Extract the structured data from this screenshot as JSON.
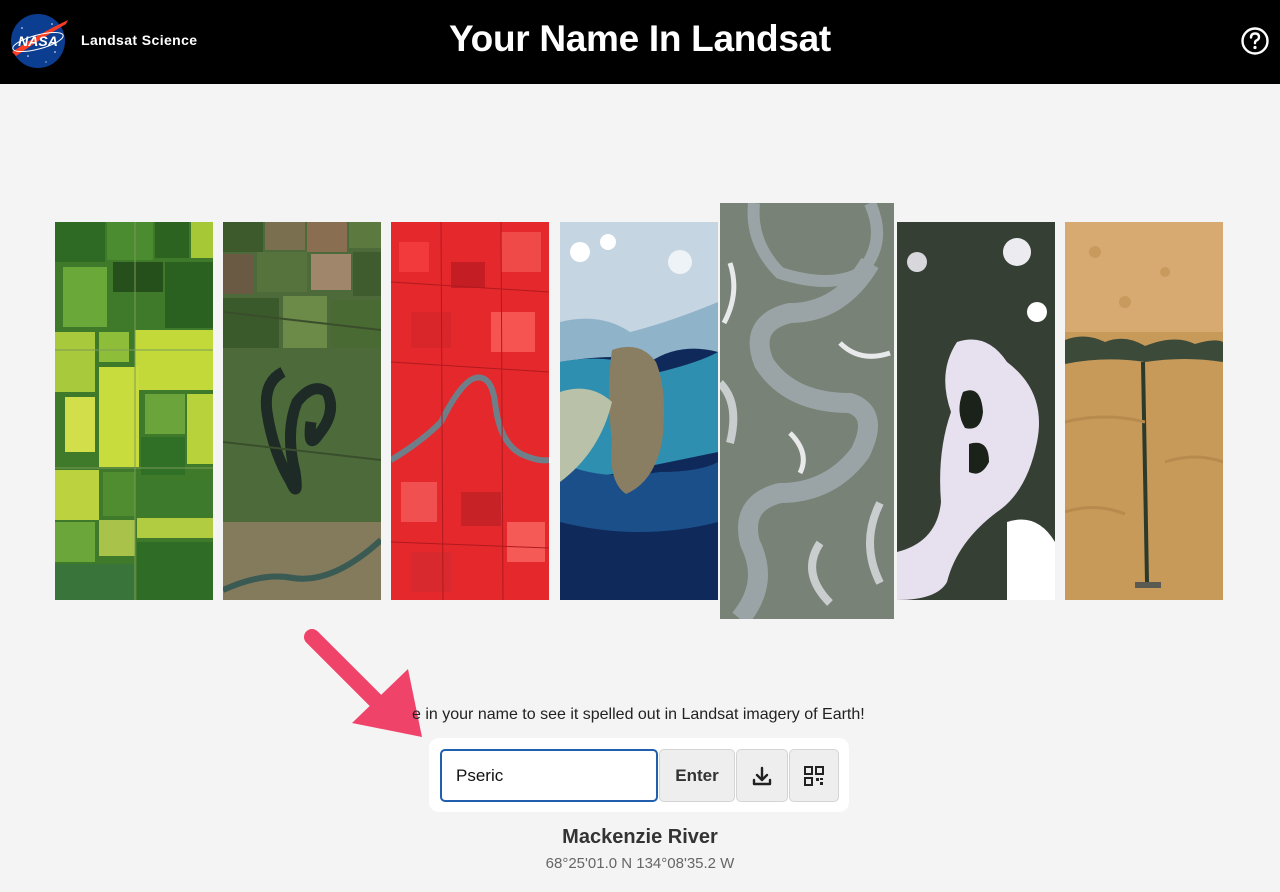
{
  "header": {
    "logo_text": "NASA",
    "brand": "Landsat Science",
    "title": "Your Name In Landsat",
    "help_icon": "help-circle-icon"
  },
  "letters": [
    {
      "name": "tile-1",
      "palette": "green-farmland"
    },
    {
      "name": "tile-2",
      "palette": "green-brown-fields-river"
    },
    {
      "name": "tile-3",
      "palette": "red-false-color-river"
    },
    {
      "name": "tile-4",
      "palette": "blue-sea-island"
    },
    {
      "name": "tile-5",
      "palette": "dark-green-meandering-river",
      "selected": true
    },
    {
      "name": "tile-6",
      "palette": "dark-snow-lake"
    },
    {
      "name": "tile-7",
      "palette": "sand-desert"
    }
  ],
  "prompt": "e in your name to see it spelled out in Landsat imagery of Earth!",
  "input": {
    "value": "Pseric",
    "enter_label": "Enter",
    "download_icon": "download-icon",
    "qr_icon": "qr-code-icon"
  },
  "location": {
    "name": "Mackenzie River",
    "coords": "68°25'01.0 N 134°08'35.2 W"
  },
  "colors": {
    "header_bg": "#000000",
    "page_bg": "#f4f4f4",
    "input_border": "#1f5fae",
    "arrow": "#f0436a"
  }
}
